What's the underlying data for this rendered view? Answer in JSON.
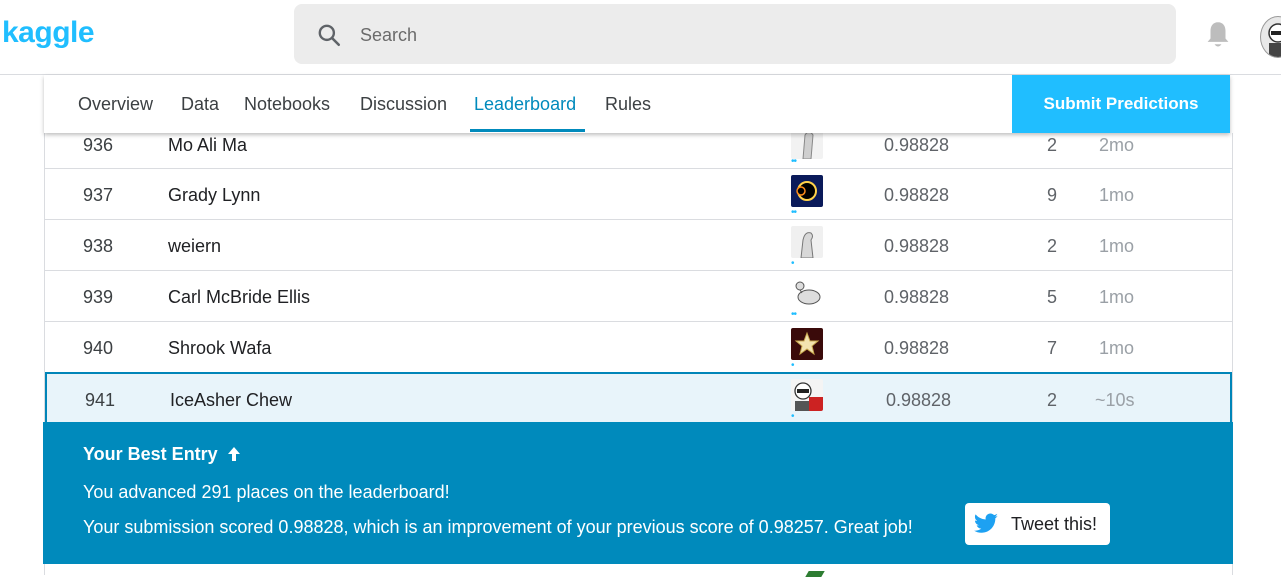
{
  "header": {
    "logo": "kaggle",
    "search_placeholder": "Search"
  },
  "tabs": [
    {
      "label": "Overview",
      "active": false
    },
    {
      "label": "Data",
      "active": false
    },
    {
      "label": "Notebooks",
      "active": false
    },
    {
      "label": "Discussion",
      "active": false
    },
    {
      "label": "Leaderboard",
      "active": true
    },
    {
      "label": "Rules",
      "active": false
    }
  ],
  "submit_label": "Submit Predictions",
  "rows": [
    {
      "rank": "936",
      "team": "Mo Ali Ma",
      "score": "0.98828",
      "entries": "2",
      "last": "2mo",
      "members_indicator": "••"
    },
    {
      "rank": "937",
      "team": "Grady Lynn",
      "score": "0.98828",
      "entries": "9",
      "last": "1mo",
      "members_indicator": "••"
    },
    {
      "rank": "938",
      "team": "weiern",
      "score": "0.98828",
      "entries": "2",
      "last": "1mo",
      "members_indicator": "•"
    },
    {
      "rank": "939",
      "team": "Carl McBride Ellis",
      "score": "0.98828",
      "entries": "5",
      "last": "1mo",
      "members_indicator": "••"
    },
    {
      "rank": "940",
      "team": "Shrook Wafa",
      "score": "0.98828",
      "entries": "7",
      "last": "1mo",
      "members_indicator": "•"
    },
    {
      "rank": "941",
      "team": "IceAsher Chew",
      "score": "0.98828",
      "entries": "2",
      "last": "~10s",
      "members_indicator": "•"
    }
  ],
  "banner": {
    "title": "Your Best Entry",
    "advanced": "You advanced 291 places on the leaderboard!",
    "improvement": "Your submission scored 0.98828, which is an improvement of your previous score of 0.98257. Great job!",
    "tweet_label": "Tweet this!"
  },
  "colors": {
    "accent": "#20beff",
    "banner": "#008abc",
    "highlight_row": "#e8f4fa"
  }
}
